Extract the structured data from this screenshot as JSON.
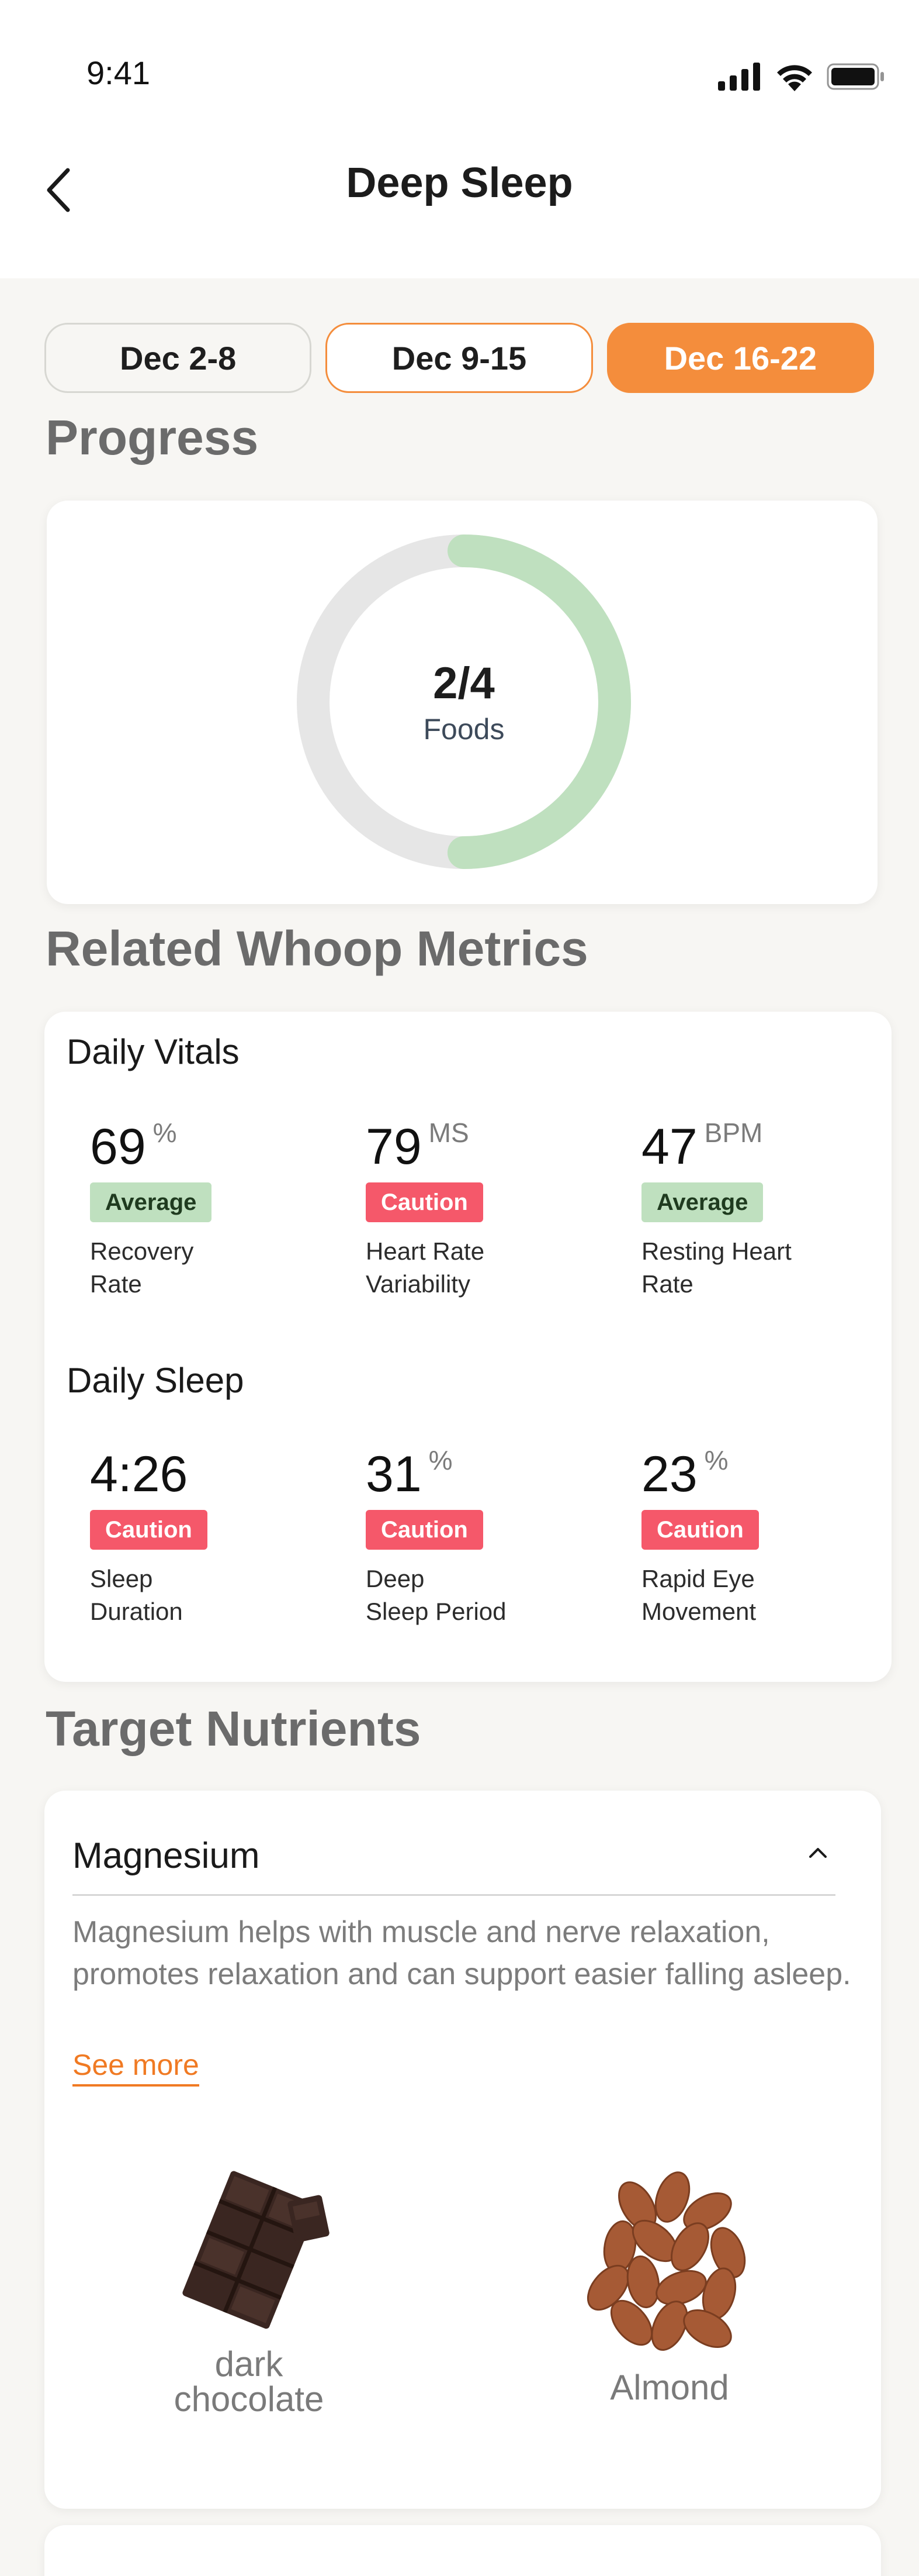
{
  "status_bar": {
    "time": "9:41"
  },
  "nav": {
    "title": "Deep Sleep"
  },
  "date_tabs": [
    {
      "label": "Dec 2-8",
      "state": "default"
    },
    {
      "label": "Dec 9-15",
      "state": "outlined"
    },
    {
      "label": "Dec 16-22",
      "state": "active"
    }
  ],
  "progress": {
    "section_title": "Progress",
    "value": "2/4",
    "label": "Foods",
    "completed": 2,
    "total": 4,
    "ring_color": "#bfe0bf",
    "track_color": "#e6e6e6"
  },
  "metrics": {
    "section_title": "Related Whoop Metrics",
    "vitals_title": "Daily Vitals",
    "vitals": [
      {
        "value": "69",
        "unit": "%",
        "badge": "Average",
        "status": "average",
        "label": "Recovery\nRate"
      },
      {
        "value": "79",
        "unit": "MS",
        "badge": "Caution",
        "status": "caution",
        "label": "Heart Rate\nVariability"
      },
      {
        "value": "47",
        "unit": "BPM",
        "badge": "Average",
        "status": "average",
        "label": "Resting Heart\nRate"
      }
    ],
    "sleep_title": "Daily Sleep",
    "sleep": [
      {
        "value": "4:26",
        "unit": "",
        "badge": "Caution",
        "status": "caution",
        "label": "Sleep\nDuration"
      },
      {
        "value": "31",
        "unit": "%",
        "badge": "Caution",
        "status": "caution",
        "label": "Deep\nSleep Period"
      },
      {
        "value": "23",
        "unit": "%",
        "badge": "Caution",
        "status": "caution",
        "label": "Rapid Eye\nMovement"
      }
    ]
  },
  "nutrients": {
    "section_title": "Target Nutrients",
    "name": "Magnesium",
    "description": "Magnesium helps with muscle and nerve relaxation, promotes relaxation and can support easier falling asleep.",
    "see_more": "See more",
    "foods": [
      {
        "label": "dark\nchocolate",
        "icon": "dark-chocolate-image"
      },
      {
        "label": "Almond",
        "icon": "almond-image"
      }
    ]
  },
  "colors": {
    "accent": "#f48d3c",
    "average": "#bfe0bf",
    "caution": "#f5586a",
    "link": "#f07a23"
  }
}
